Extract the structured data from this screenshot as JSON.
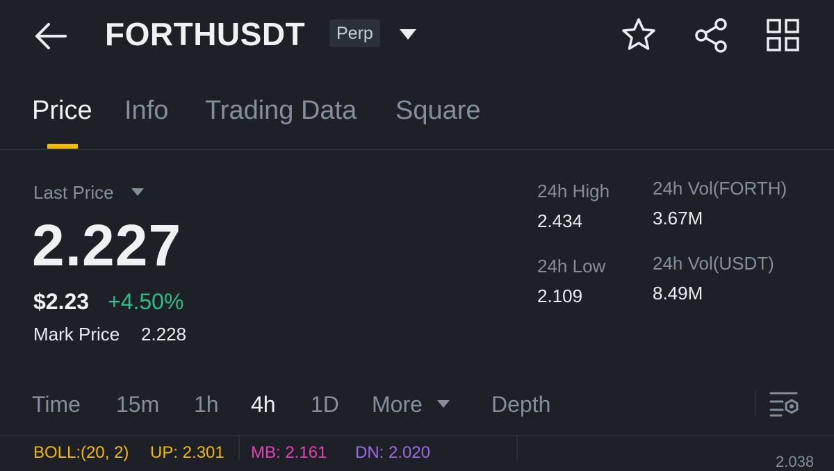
{
  "header": {
    "back_icon": "arrow-left-icon",
    "symbol": "FORTHUSDT",
    "badge": "Perp",
    "dropdown_icon": "caret-down-icon",
    "favorite_icon": "star-icon",
    "share_icon": "share-icon",
    "more_icon": "grid-icon"
  },
  "tabs": [
    {
      "label": "Price",
      "active": true
    },
    {
      "label": "Info",
      "active": false
    },
    {
      "label": "Trading Data",
      "active": false
    },
    {
      "label": "Square",
      "active": false
    }
  ],
  "price": {
    "last_price_label": "Last Price",
    "last_price": "2.227",
    "usd_price": "$2.23",
    "change": "+4.50%",
    "mark_price_label": "Mark Price",
    "mark_price": "2.228"
  },
  "stats": {
    "high_label": "24h High",
    "high": "2.434",
    "low_label": "24h Low",
    "low": "2.109",
    "vol_base_label": "24h Vol(FORTH)",
    "vol_base": "3.67M",
    "vol_quote_label": "24h Vol(USDT)",
    "vol_quote": "8.49M"
  },
  "intervals": {
    "items": [
      {
        "label": "Time",
        "active": false
      },
      {
        "label": "15m",
        "active": false
      },
      {
        "label": "1h",
        "active": false
      },
      {
        "label": "4h",
        "active": true
      },
      {
        "label": "1D",
        "active": false
      },
      {
        "label": "More",
        "active": false
      },
      {
        "label": "Depth",
        "active": false
      }
    ],
    "settings_icon": "chart-settings-icon"
  },
  "indicator": {
    "name": "BOLL:(20, 2)",
    "up": "UP: 2.301",
    "mb": "MB: 2.161",
    "dn": "DN: 2.020",
    "axis_value": "2.038"
  },
  "colors": {
    "accent": "#f0b90b",
    "positive": "#2ebd85",
    "boll": "#f0b90b",
    "mb": "#e440b3",
    "dn": "#9a6ce0",
    "background": "#1e2027"
  }
}
